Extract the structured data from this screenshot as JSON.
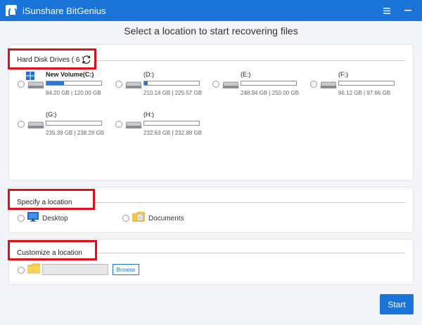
{
  "window": {
    "title": "iSunshare BitGenius"
  },
  "header": {
    "text": "Select a location to start recovering files"
  },
  "hdd_section": {
    "title": "Hard Disk Drives ( 6 )",
    "drives": [
      {
        "name": "New Volume(C:)",
        "size": "84.20 GB | 120.00 GB",
        "used_pct": 32,
        "system": true
      },
      {
        "name": "(D:)",
        "size": "210.14 GB | 225.57 GB",
        "used_pct": 7,
        "system": false
      },
      {
        "name": "(E:)",
        "size": "248.94 GB | 250.00 GB",
        "used_pct": 0,
        "system": false
      },
      {
        "name": "(F:)",
        "size": "96.12 GB | 97.66 GB",
        "used_pct": 0,
        "system": false
      },
      {
        "name": "(G:)",
        "size": "235.39 GB | 238.28 GB",
        "used_pct": 0,
        "system": false
      },
      {
        "name": "(H:)",
        "size": "232.63 GB | 232.88 GB",
        "used_pct": 0,
        "system": false
      }
    ]
  },
  "specify_section": {
    "title": "Specify a location",
    "items": [
      {
        "label": "Desktop"
      },
      {
        "label": "Documents"
      }
    ]
  },
  "customize_section": {
    "title": "Customize a location",
    "path_value": "",
    "browse_label": "Browse"
  },
  "start_label": "Start",
  "colors": {
    "accent": "#1a73d6",
    "highlight": "#e0101b",
    "usage": "#2a77d8"
  }
}
